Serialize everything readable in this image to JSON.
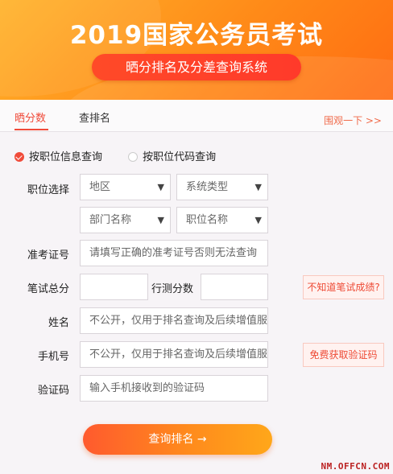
{
  "banner": {
    "title": "2019国家公务员考试",
    "subtitle": "晒分排名及分差查询系统"
  },
  "tabs": [
    {
      "label": "晒分数",
      "active": true
    },
    {
      "label": "查排名",
      "active": false
    }
  ],
  "look_link": "围观一下 >>",
  "query_mode": {
    "options": [
      {
        "label": "按职位信息查询",
        "selected": true
      },
      {
        "label": "按职位代码查询",
        "selected": false
      }
    ]
  },
  "form": {
    "position_label": "职位选择",
    "region_select": "地区",
    "system_select": "系统类型",
    "dept_select": "部门名称",
    "job_select": "职位名称",
    "exam_no_label": "准考证号",
    "exam_no_placeholder": "请填写正确的准考证号否则无法查询",
    "written_score_label": "笔试总分",
    "written_score_value": "",
    "aptitude_score_label": "行测分数",
    "aptitude_score_value": "",
    "unknown_score_hint": "不知道笔试成绩?",
    "name_label": "姓名",
    "name_placeholder": "不公开，仅用于排名查询及后续增值服务",
    "phone_label": "手机号",
    "phone_placeholder": "不公开，仅用于排名查询及后续增值服务",
    "get_code_button": "免费获取验证码",
    "code_label": "验证码",
    "code_placeholder": "输入手机接收到的验证码",
    "submit_label": "查询排名 →"
  },
  "watermark": "NM.OFFCN.COM",
  "colors": {
    "accent": "#f04b3a",
    "banner_orange": "#ff8a18",
    "button_gradient_start": "#ff5a2e",
    "button_gradient_end": "#ffa71a"
  }
}
